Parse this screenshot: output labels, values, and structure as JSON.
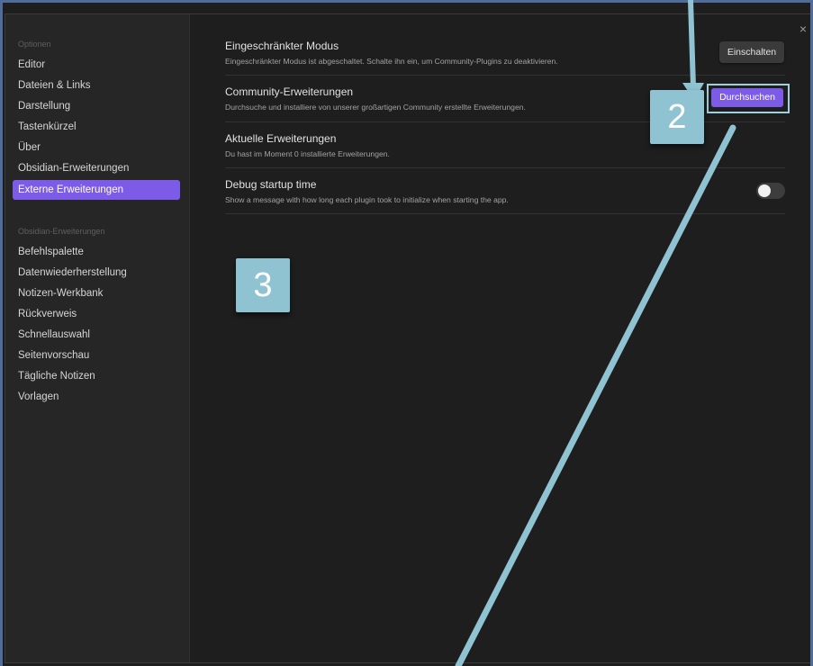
{
  "dialog": {
    "close_glyph": "×"
  },
  "sidebar": {
    "section1_heading": "Optionen",
    "section1_items": [
      {
        "label": "Editor"
      },
      {
        "label": "Dateien & Links"
      },
      {
        "label": "Darstellung"
      },
      {
        "label": "Tastenkürzel"
      },
      {
        "label": "Über"
      },
      {
        "label": "Obsidian-Erweiterungen"
      },
      {
        "label": "Externe Erweiterungen",
        "active": true
      }
    ],
    "section2_heading": "Obsidian-Erweiterungen",
    "section2_items": [
      {
        "label": "Befehlspalette"
      },
      {
        "label": "Datenwiederherstellung"
      },
      {
        "label": "Notizen-Werkbank"
      },
      {
        "label": "Rückverweis"
      },
      {
        "label": "Schnellauswahl"
      },
      {
        "label": "Seitenvorschau"
      },
      {
        "label": "Tägliche Notizen"
      },
      {
        "label": "Vorlagen"
      }
    ]
  },
  "settings": [
    {
      "name": "Eingeschränkter Modus",
      "desc": "Eingeschränkter Modus ist abgeschaltet. Schalte ihn ein, um Community-Plugins zu deaktivieren.",
      "button_label": "Einschalten"
    },
    {
      "name": "Community-Erweiterungen",
      "desc": "Durchsuche und installiere von unserer großartigen Community erstellte Erweiterungen.",
      "button_label": "Durchsuchen"
    },
    {
      "name": "Aktuelle Erweiterungen",
      "desc": "Du hast im Moment 0 installierte Erweiterungen."
    },
    {
      "name": "Debug startup time",
      "desc": "Show a message with how long each plugin took to initialize when starting the app.",
      "toggle_on": false
    }
  ],
  "annotations": {
    "step2": "2",
    "step3": "3",
    "color": "#8fc3d1"
  },
  "colors": {
    "accent": "#7c5ce6",
    "frame": "#4f6d98"
  }
}
